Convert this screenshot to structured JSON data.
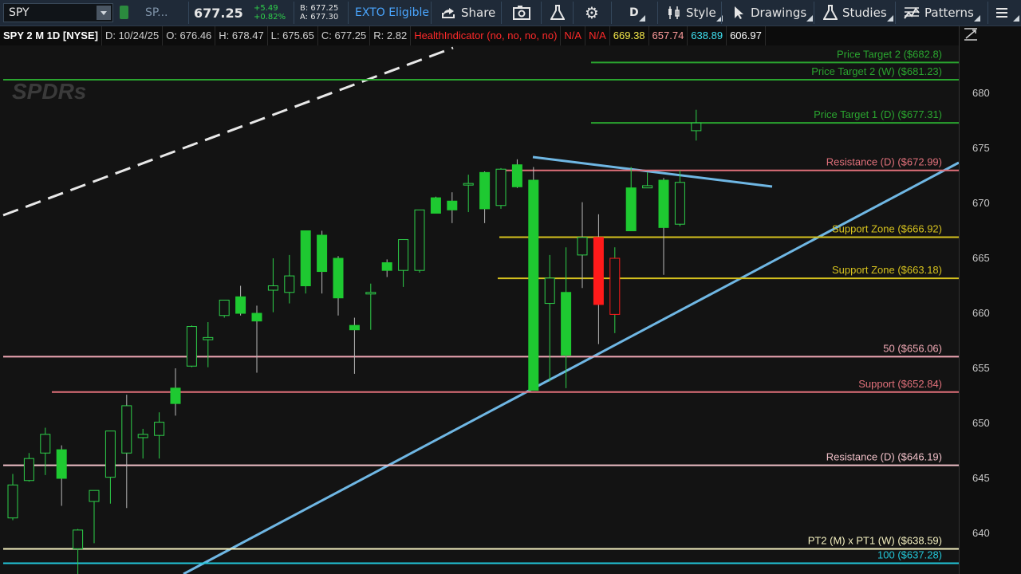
{
  "toolbar": {
    "symbol": "SPY",
    "compare_symbol": "SP...",
    "last_price": "677.25",
    "change": "+5.49",
    "change_pct": "+0.82%",
    "bid": "B: 677.25",
    "ask": "A: 677.30",
    "exto": "EXTO Eligible",
    "share_label": "Share",
    "timeframe_label": "D",
    "style_label": "Style",
    "drawings_label": "Drawings",
    "studies_label": "Studies",
    "patterns_label": "Patterns"
  },
  "infobar": {
    "title": "SPY 2 M 1D [NYSE]",
    "date": "D: 10/24/25",
    "open": "O: 676.46",
    "high": "H: 678.47",
    "low": "L: 675.65",
    "close": "C: 677.25",
    "range": "R: 2.82",
    "indicator": "HealthIndicator (no, no, no, no)",
    "na1": "N/A",
    "na2": "N/A",
    "v1": "669.38",
    "v2": "657.74",
    "v3": "638.89",
    "v4": "606.97"
  },
  "watermark": "SPDRs",
  "colors": {
    "up": "#1ec931",
    "down": "#ff1a1a",
    "toolbar_bg": "#1f2a38",
    "chart_bg": "#131313"
  },
  "chart_data": {
    "type": "candlestick",
    "y_axis_ticks": [
      640,
      645,
      650,
      655,
      660,
      665,
      670,
      675,
      680
    ],
    "ylim": [
      635.8,
      683.2
    ],
    "grid": false,
    "candles": [
      {
        "o": 641.4,
        "h": 645.4,
        "l": 641.2,
        "c": 644.4,
        "up": false
      },
      {
        "o": 644.8,
        "h": 647.3,
        "l": 644.7,
        "c": 646.8,
        "up": false
      },
      {
        "o": 647.3,
        "h": 649.6,
        "l": 645.3,
        "c": 649.0,
        "up": false
      },
      {
        "o": 647.6,
        "h": 648.0,
        "l": 642.5,
        "c": 645.0,
        "up": true
      },
      {
        "o": 638.6,
        "h": 640.4,
        "l": 634.4,
        "c": 640.3,
        "up": false
      },
      {
        "o": 642.9,
        "h": 643.9,
        "l": 639.1,
        "c": 643.9,
        "up": false
      },
      {
        "o": 645.1,
        "h": 649.3,
        "l": 642.7,
        "c": 649.3,
        "up": false
      },
      {
        "o": 647.3,
        "h": 652.6,
        "l": 642.3,
        "c": 651.6,
        "up": true
      },
      {
        "o": 648.7,
        "h": 649.5,
        "l": 646.8,
        "c": 649.0,
        "up": false
      },
      {
        "o": 648.9,
        "h": 651.0,
        "l": 646.8,
        "c": 650.1,
        "up": false
      },
      {
        "o": 653.2,
        "h": 655.0,
        "l": 650.7,
        "c": 651.8,
        "up": true
      },
      {
        "o": 655.2,
        "h": 658.9,
        "l": 655.1,
        "c": 658.8,
        "up": false
      },
      {
        "o": 657.6,
        "h": 659.2,
        "l": 655.1,
        "c": 657.8,
        "up": false
      },
      {
        "o": 659.8,
        "h": 661.2,
        "l": 659.6,
        "c": 661.2,
        "up": false
      },
      {
        "o": 661.5,
        "h": 662.5,
        "l": 659.8,
        "c": 660.0,
        "up": true
      },
      {
        "o": 660.0,
        "h": 660.7,
        "l": 654.6,
        "c": 659.3,
        "up": true
      },
      {
        "o": 662.1,
        "h": 665.0,
        "l": 660.1,
        "c": 662.5,
        "up": false
      },
      {
        "o": 661.9,
        "h": 665.3,
        "l": 660.9,
        "c": 663.4,
        "up": false
      },
      {
        "o": 667.5,
        "h": 667.5,
        "l": 661.8,
        "c": 662.5,
        "up": false
      },
      {
        "o": 667.1,
        "h": 667.5,
        "l": 661.8,
        "c": 663.8,
        "up": true
      },
      {
        "o": 665.0,
        "h": 665.2,
        "l": 659.8,
        "c": 661.4,
        "up": true
      },
      {
        "o": 658.9,
        "h": 659.6,
        "l": 654.5,
        "c": 658.5,
        "up": true
      },
      {
        "o": 661.8,
        "h": 662.7,
        "l": 658.5,
        "c": 661.9,
        "up": false
      },
      {
        "o": 664.6,
        "h": 664.9,
        "l": 663.3,
        "c": 663.9,
        "up": true
      },
      {
        "o": 663.9,
        "h": 666.7,
        "l": 662.4,
        "c": 666.7,
        "up": false
      },
      {
        "o": 663.9,
        "h": 669.4,
        "l": 663.7,
        "c": 669.4,
        "up": false
      },
      {
        "o": 670.5,
        "h": 670.6,
        "l": 669.1,
        "c": 669.1,
        "up": true
      },
      {
        "o": 670.2,
        "h": 671.0,
        "l": 668.2,
        "c": 669.4,
        "up": true
      },
      {
        "o": 671.8,
        "h": 672.6,
        "l": 669.2,
        "c": 671.8,
        "up": false
      },
      {
        "o": 672.8,
        "h": 672.9,
        "l": 668.2,
        "c": 669.5,
        "up": true
      },
      {
        "o": 669.8,
        "h": 673.2,
        "l": 669.5,
        "c": 673.1,
        "up": false
      },
      {
        "o": 673.5,
        "h": 674.0,
        "l": 671.4,
        "c": 671.5,
        "up": true
      },
      {
        "o": 672.1,
        "h": 673.3,
        "l": 653.0,
        "c": 653.0,
        "up": true
      },
      {
        "o": 660.9,
        "h": 665.3,
        "l": 653.8,
        "c": 663.2,
        "up": false
      },
      {
        "o": 661.9,
        "h": 666.0,
        "l": 653.2,
        "c": 656.2,
        "up": false
      },
      {
        "o": 665.3,
        "h": 670.1,
        "l": 662.3,
        "c": 666.9,
        "up": true
      },
      {
        "o": 660.8,
        "h": 669.0,
        "l": 657.2,
        "c": 666.9,
        "up": true
      },
      {
        "o": 665.0,
        "h": 666.0,
        "l": 658.2,
        "c": 659.9,
        "up": false
      },
      {
        "o": 671.4,
        "h": 673.3,
        "l": 667.5,
        "c": 667.5,
        "up": false
      },
      {
        "o": 671.4,
        "h": 672.8,
        "l": 671.6,
        "c": 671.6,
        "up": false
      },
      {
        "o": 672.1,
        "h": 672.3,
        "l": 663.5,
        "c": 667.8,
        "up": true
      },
      {
        "o": 668.1,
        "h": 673.0,
        "l": 667.9,
        "c": 671.9,
        "up": false
      },
      {
        "o": 676.6,
        "h": 678.5,
        "l": 675.7,
        "c": 677.3,
        "up": false
      }
    ],
    "horizontal_levels": [
      {
        "label": "Price Target 2 ($682.8)",
        "value": 682.8,
        "color": "#2aa52f"
      },
      {
        "label": "Price Target 2 (W) ($681.23)",
        "value": 681.23,
        "color": "#2aa52f"
      },
      {
        "label": "Price Target 1 (D) ($677.31)",
        "value": 677.31,
        "color": "#2aa52f"
      },
      {
        "label": "Resistance (D) ($672.99)",
        "value": 672.99,
        "color": "#e0707a"
      },
      {
        "label": "Support Zone ($666.92)",
        "value": 666.92,
        "color": "#d6c21e"
      },
      {
        "label": "Support Zone ($663.18)",
        "value": 663.18,
        "color": "#d6c21e"
      },
      {
        "label": "50 ($656.06)",
        "value": 656.06,
        "color": "#f0a8b4"
      },
      {
        "label": "Support ($652.84)",
        "value": 652.84,
        "color": "#e0707a"
      },
      {
        "label": "Resistance (D) ($646.19)",
        "value": 646.19,
        "color": "#f0c0c8"
      },
      {
        "label": "PT2 (M) x PT1 (W) ($638.59)",
        "value": 638.59,
        "color": "#f4f0c0"
      },
      {
        "label": "100 ($637.28)",
        "value": 637.28,
        "color": "#22c6d8"
      }
    ]
  }
}
